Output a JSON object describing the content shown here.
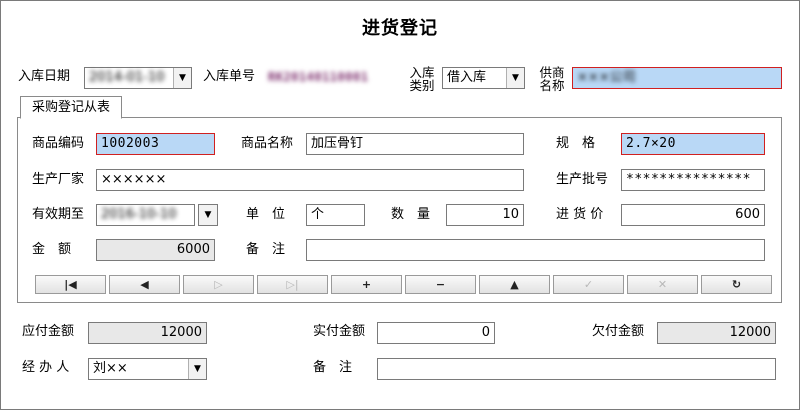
{
  "title": "进货登记",
  "header": {
    "date_label": "入库日期",
    "date_value": "2014-01-10",
    "order_no_label": "入库单号",
    "order_no_value": "RK20140110001",
    "type_label_line1": "入库",
    "type_label_line2": "类别",
    "type_value": "借入库",
    "supplier_label_line1": "供商",
    "supplier_label_line2": "名称",
    "supplier_value": "×××公司"
  },
  "tab": {
    "label": "采购登记从表"
  },
  "detail": {
    "code_label": "商品编码",
    "code_value": "1002003",
    "name_label": "商品名称",
    "name_value": "加压骨钉",
    "spec_label": "规　格",
    "spec_value": "2.7×20",
    "maker_label": "生产厂家",
    "maker_value": "××××××",
    "batch_label": "生产批号",
    "batch_value": "***************",
    "expiry_label": "有效期至",
    "expiry_value": "2016-10-10",
    "unit_label": "单　位",
    "unit_value": "个",
    "qty_label": "数　量",
    "qty_value": "10",
    "price_label": "进 货 价",
    "price_value": "600",
    "amount_label": "金　额",
    "amount_value": "6000",
    "remark_label": "备　注",
    "remark_value": ""
  },
  "nav": {
    "first": "|◀",
    "prev": "◀",
    "next": "▷",
    "last": "▷|",
    "add": "+",
    "delete": "−",
    "edit": "▲",
    "save": "✓",
    "cancel": "✕",
    "refresh": "↻"
  },
  "footer": {
    "payable_label": "应付金额",
    "payable_value": "12000",
    "paid_label": "实付金额",
    "paid_value": "0",
    "owed_label": "欠付金额",
    "owed_value": "12000",
    "handler_label": "经 办 人",
    "handler_value": "刘××",
    "remark_label": "备　注",
    "remark_value": ""
  }
}
